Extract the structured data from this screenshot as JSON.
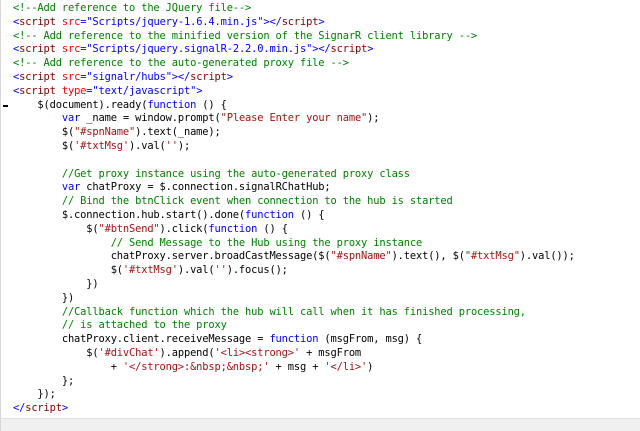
{
  "code_lines": [
    [
      [
        "c",
        "<!--Add reference to the JQuery file-->"
      ]
    ],
    [
      [
        "k",
        "<"
      ],
      [
        "t",
        "script"
      ],
      [
        "a",
        " src"
      ],
      [
        "k",
        "=\""
      ],
      [
        "k",
        "Scripts/jquery-1.6.4.min.js"
      ],
      [
        "k",
        "\"></"
      ],
      [
        "t",
        "script"
      ],
      [
        "k",
        ">"
      ]
    ],
    [
      [
        "c",
        "<!-- Add reference to the minified version of the SignarR client library -->"
      ]
    ],
    [
      [
        "k",
        "<"
      ],
      [
        "t",
        "script"
      ],
      [
        "a",
        " src"
      ],
      [
        "k",
        "=\""
      ],
      [
        "k",
        "Scripts/jquery.signalR-2.2.0.min.js"
      ],
      [
        "k",
        "\"></"
      ],
      [
        "t",
        "script"
      ],
      [
        "k",
        ">"
      ]
    ],
    [
      [
        "c",
        "<!-- Add reference to the auto-generated proxy file -->"
      ]
    ],
    [
      [
        "k",
        "<"
      ],
      [
        "t",
        "script"
      ],
      [
        "a",
        " src"
      ],
      [
        "k",
        "=\""
      ],
      [
        "k",
        "signalr/hubs"
      ],
      [
        "k",
        "\"></"
      ],
      [
        "t",
        "script"
      ],
      [
        "k",
        ">"
      ]
    ],
    [
      [
        "k",
        "<"
      ],
      [
        "t",
        "script"
      ],
      [
        "a",
        " type"
      ],
      [
        "k",
        "=\""
      ],
      [
        "k",
        "text/javascript"
      ],
      [
        "k",
        "\">"
      ]
    ],
    [
      [
        "p",
        "    $(document).ready("
      ],
      [
        "k",
        "function"
      ],
      [
        "p",
        " () {"
      ]
    ],
    [
      [
        "p",
        "        "
      ],
      [
        "k",
        "var"
      ],
      [
        "p",
        " _name = window.prompt("
      ],
      [
        "s",
        "\"Please Enter your name\""
      ],
      [
        "p",
        ");"
      ]
    ],
    [
      [
        "p",
        "        $("
      ],
      [
        "s",
        "\"#spnName\""
      ],
      [
        "p",
        ").text(_name);"
      ]
    ],
    [
      [
        "p",
        "        $("
      ],
      [
        "s",
        "'#txtMsg'"
      ],
      [
        "p",
        ").val("
      ],
      [
        "s",
        "''"
      ],
      [
        "p",
        ");"
      ]
    ],
    [],
    [
      [
        "p",
        "        "
      ],
      [
        "c",
        "//Get proxy instance using the auto-generated proxy class"
      ]
    ],
    [
      [
        "p",
        "        "
      ],
      [
        "k",
        "var"
      ],
      [
        "p",
        " chatProxy = $.connection.signalRChatHub;"
      ]
    ],
    [
      [
        "p",
        "        "
      ],
      [
        "c",
        "// Bind the btnClick event when connection to the hub is started"
      ]
    ],
    [
      [
        "p",
        "        $.connection.hub.start().done("
      ],
      [
        "k",
        "function"
      ],
      [
        "p",
        " () {"
      ]
    ],
    [
      [
        "p",
        "            $("
      ],
      [
        "s",
        "\"#btnSend\""
      ],
      [
        "p",
        ").click("
      ],
      [
        "k",
        "function"
      ],
      [
        "p",
        " () {"
      ]
    ],
    [
      [
        "p",
        "                "
      ],
      [
        "c",
        "// Send Message to the Hub using the proxy instance"
      ]
    ],
    [
      [
        "p",
        "                chatProxy.server.broadCastMessage($("
      ],
      [
        "s",
        "\"#spnName\""
      ],
      [
        "p",
        ").text(), $("
      ],
      [
        "s",
        "\"#txtMsg\""
      ],
      [
        "p",
        ").val());"
      ]
    ],
    [
      [
        "p",
        "                $("
      ],
      [
        "s",
        "'#txtMsg'"
      ],
      [
        "p",
        ").val("
      ],
      [
        "s",
        "''"
      ],
      [
        "p",
        ").focus();"
      ]
    ],
    [
      [
        "p",
        "            })"
      ]
    ],
    [
      [
        "p",
        "        })"
      ]
    ],
    [
      [
        "p",
        "        "
      ],
      [
        "c",
        "//Callback function which the hub will call when it has finished processing,"
      ]
    ],
    [
      [
        "p",
        "        "
      ],
      [
        "c",
        "// is attached to the proxy"
      ]
    ],
    [
      [
        "p",
        "        chatProxy.client.receiveMessage = "
      ],
      [
        "k",
        "function"
      ],
      [
        "p",
        " (msgFrom, msg) {"
      ]
    ],
    [
      [
        "p",
        "            $("
      ],
      [
        "s",
        "'#divChat'"
      ],
      [
        "p",
        ").append("
      ],
      [
        "s",
        "'<li><strong>'"
      ],
      [
        "p",
        " + msgFrom"
      ]
    ],
    [
      [
        "p",
        "                + "
      ],
      [
        "s",
        "'</strong>:&nbsp;&nbsp;'"
      ],
      [
        "p",
        " + msg + "
      ],
      [
        "s",
        "'</li>'"
      ],
      [
        "p",
        ")"
      ]
    ],
    [
      [
        "p",
        "        };"
      ]
    ],
    [
      [
        "p",
        "    });"
      ]
    ],
    [
      [
        "k",
        "</"
      ],
      [
        "t",
        "script"
      ],
      [
        "k",
        ">"
      ]
    ]
  ],
  "breakpoint_marker_line": 7
}
